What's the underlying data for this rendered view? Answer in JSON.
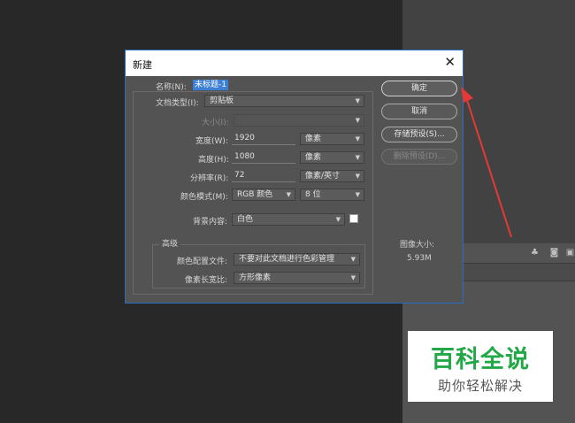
{
  "dialog": {
    "title": "新建",
    "close_glyph": "✕",
    "name_label": "名称(N):",
    "name_value": "未标题-1",
    "doc_type_label": "文档类型(I):",
    "doc_type_value": "剪贴板",
    "size_label": "大小(I):",
    "size_value": "",
    "width_label": "宽度(W):",
    "width_value": "1920",
    "width_unit": "像素",
    "height_label": "高度(H):",
    "height_value": "1080",
    "height_unit": "像素",
    "resolution_label": "分辨率(R):",
    "resolution_value": "72",
    "resolution_unit": "像素/英寸",
    "color_mode_label": "颜色模式(M):",
    "color_mode_value": "RGB 颜色",
    "bit_depth_value": "8 位",
    "background_label": "背景内容:",
    "background_value": "白色",
    "advanced_title": "高级",
    "color_profile_label": "颜色配置文件:",
    "color_profile_value": "不要对此文档进行色彩管理",
    "pixel_aspect_label": "像素长宽比:",
    "pixel_aspect_value": "方形像素",
    "image_size_label": "图像大小:",
    "image_size_value": "5.93M",
    "buttons": {
      "ok": "确定",
      "cancel": "取消",
      "save_preset": "存储预设(S)...",
      "delete_preset": "删除预设(D)..."
    }
  },
  "watermark": {
    "title": "百科全说",
    "subtitle": "助你轻松解决"
  },
  "colors": {
    "dialog_bg": "#535353",
    "selection": "#3c7fd4",
    "arrow": "#e53935",
    "watermark_green": "#23a847"
  }
}
